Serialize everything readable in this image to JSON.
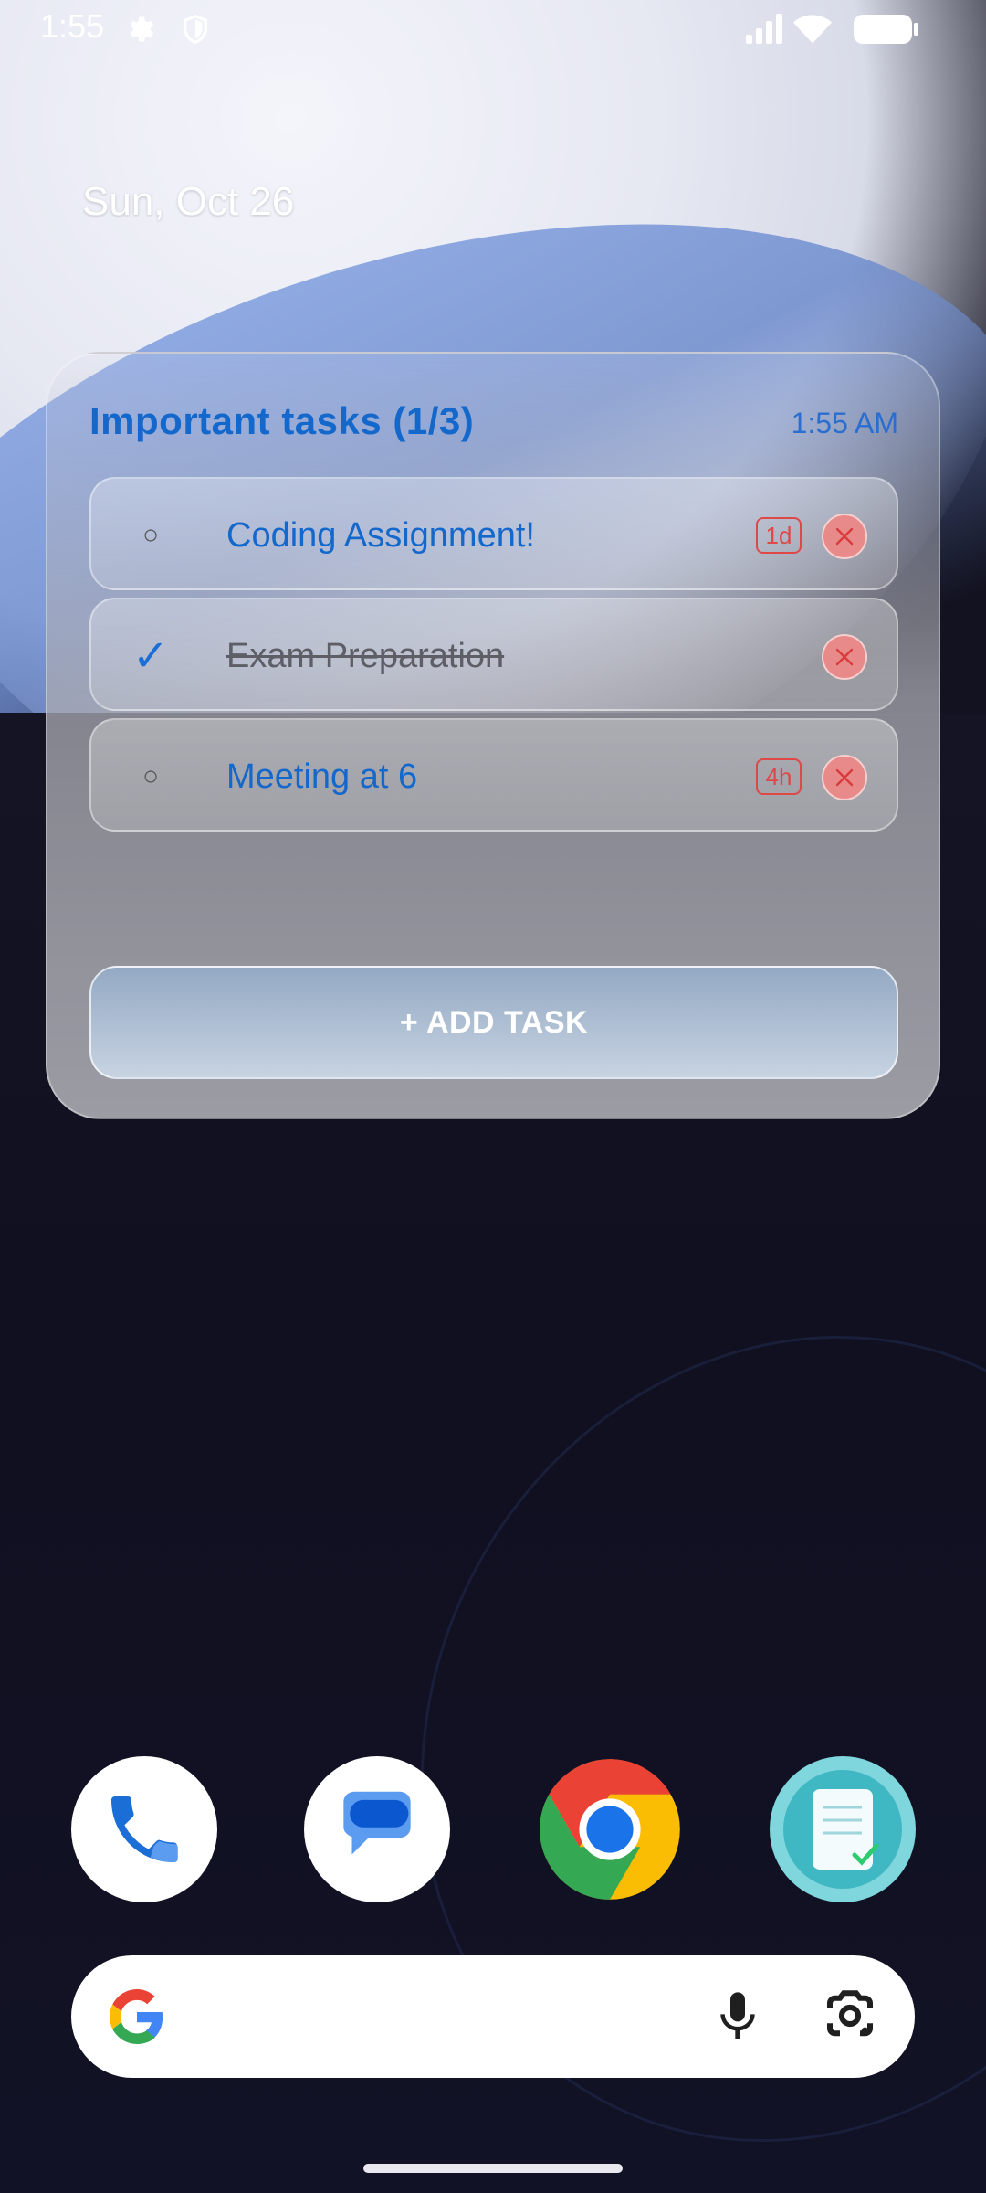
{
  "status_bar": {
    "time": "1:55",
    "icons": [
      "gear-icon",
      "shield-icon",
      "signal-icon",
      "wifi-icon",
      "battery-icon"
    ]
  },
  "date": "Sun, Oct 26",
  "widget": {
    "title": "Important tasks (1/3)",
    "time": "1:55 AM",
    "tasks": [
      {
        "label": "Coding Assignment!",
        "done": false,
        "check_symbol": "○",
        "due": "1d"
      },
      {
        "label": "Exam Preparation",
        "done": true,
        "check_symbol": "✓",
        "due": ""
      },
      {
        "label": "Meeting at 6",
        "done": false,
        "check_symbol": "○",
        "due": "4h"
      }
    ],
    "add_button_label": "+ ADD TASK"
  },
  "dock": {
    "apps": [
      "phone-icon",
      "messages-icon",
      "chrome-icon",
      "tasks-app-icon"
    ]
  },
  "search": {
    "icons": [
      "google-logo-icon",
      "microphone-icon",
      "lens-icon"
    ]
  },
  "colors": {
    "accent": "#1468cc",
    "danger": "#e04848",
    "delete_bg": "#e88a8a"
  }
}
